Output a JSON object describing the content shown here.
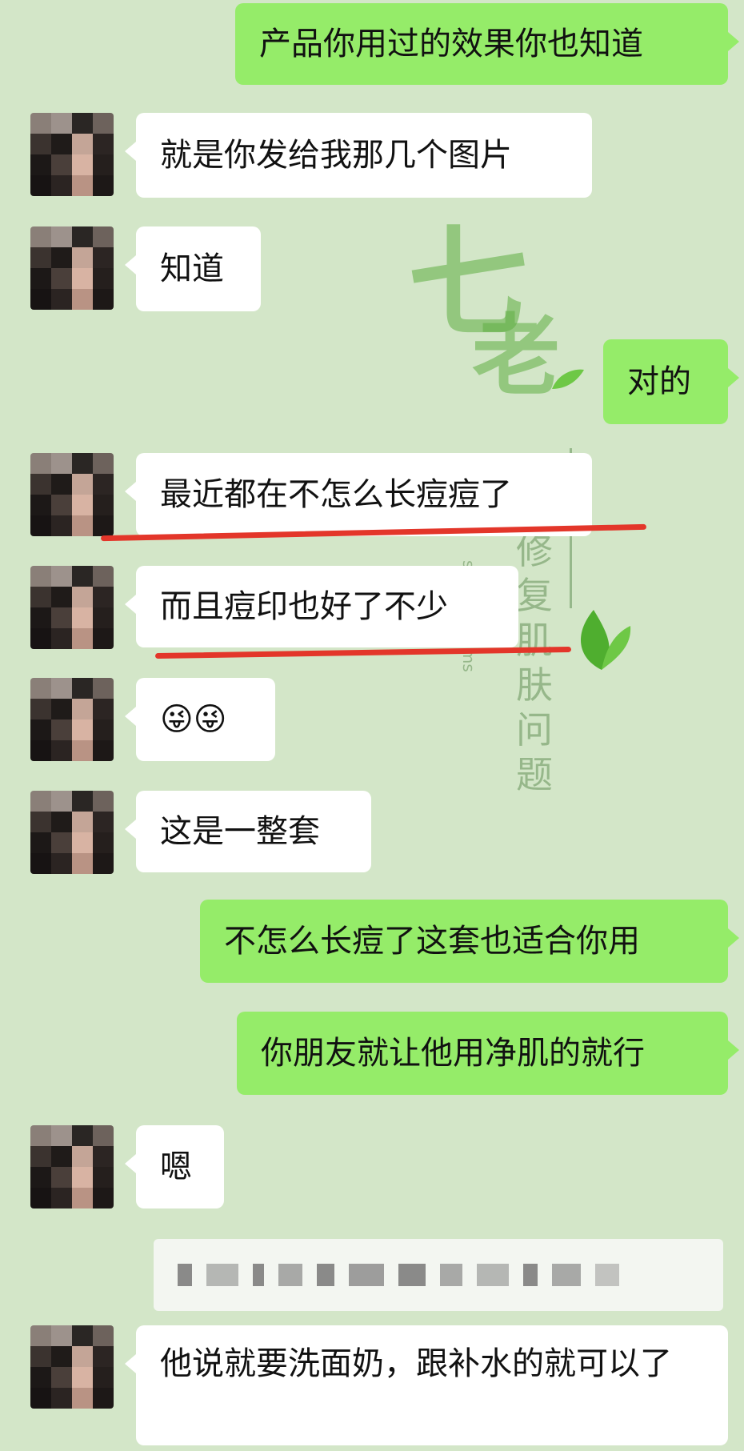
{
  "watermark": {
    "big_char_1": "七",
    "big_char_2": "老",
    "vertical_text": "修复肌肤问题",
    "english_text": "skin problems"
  },
  "messages": [
    {
      "side": "out",
      "text": "产品你用过的效果你也知道"
    },
    {
      "side": "in",
      "text": "就是你发给我那几个图片"
    },
    {
      "side": "in",
      "text": "知道"
    },
    {
      "side": "out",
      "text": "对的"
    },
    {
      "side": "in",
      "text": "最近都在不怎么长痘痘了",
      "underlined": true
    },
    {
      "side": "in",
      "text": "而且痘印也好了不少",
      "underlined": true
    },
    {
      "side": "in",
      "text": "😜😜"
    },
    {
      "side": "in",
      "text": "这是一整套"
    },
    {
      "side": "out",
      "text": "不怎么长痘了这套也适合你用"
    },
    {
      "side": "out",
      "text": "你朋友就让他用净肌的就行"
    },
    {
      "side": "in",
      "text": "嗯"
    },
    {
      "side": "in",
      "text": "他说就要洗面奶，跟补水的就可以了"
    }
  ],
  "colors": {
    "background": "#d3e6c8",
    "outgoing_bubble": "#95ec69",
    "incoming_bubble": "#ffffff",
    "underline": "#e3362a"
  }
}
